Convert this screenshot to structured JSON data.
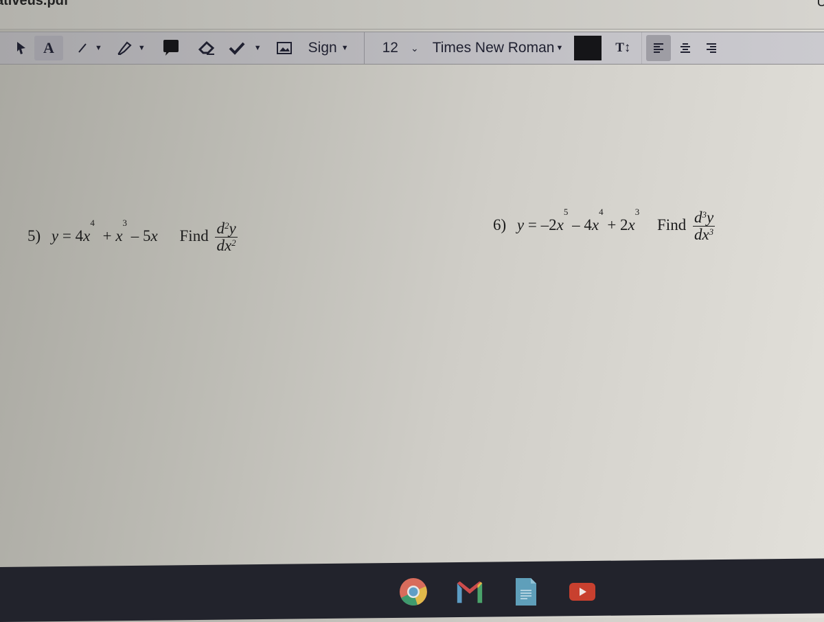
{
  "window": {
    "title_fragment": "ativeus.pdf",
    "title_right_fragment": "U"
  },
  "toolbar": {
    "tools": [
      {
        "name": "select-tool",
        "icon": "cursor-arrow-icon"
      },
      {
        "name": "text-tool",
        "icon": "text-A-icon",
        "label": "A",
        "active": true
      },
      {
        "name": "line-tool",
        "icon": "line-icon"
      },
      {
        "name": "highlighter-tool",
        "icon": "highlighter-icon"
      },
      {
        "name": "comment-tool",
        "icon": "speech-bubble-icon"
      },
      {
        "name": "eraser-tool",
        "icon": "eraser-icon"
      },
      {
        "name": "checkmark-tool",
        "icon": "checkmark-icon"
      },
      {
        "name": "image-tool",
        "icon": "image-icon"
      }
    ],
    "sign_label": "Sign",
    "font_size": "12",
    "font_family": "Times New Roman",
    "text_color": "#151518",
    "text_size_icon_label": "T↕",
    "align_options": [
      "align-left",
      "align-center",
      "align-right"
    ],
    "active_align": "align-left"
  },
  "document": {
    "problems": [
      {
        "number": "5)",
        "equation_lhs": "y",
        "equals": "=",
        "terms": [
          {
            "coef": "4",
            "var": "x",
            "exp": "4"
          },
          {
            "op": "+",
            "coef": "",
            "var": "x",
            "exp": "3"
          },
          {
            "op": "–",
            "coef": "5",
            "var": "x",
            "exp": ""
          }
        ],
        "find_label": "Find",
        "derivative": {
          "numerator": "d",
          "num_exp": "2",
          "num_var": "y",
          "denominator": "dx",
          "den_exp": "2"
        }
      },
      {
        "number": "6)",
        "equation_lhs": "y",
        "equals": "=",
        "terms": [
          {
            "coef": "–2",
            "var": "x",
            "exp": "5"
          },
          {
            "op": "–",
            "coef": "4",
            "var": "x",
            "exp": "4"
          },
          {
            "op": "+",
            "coef": "2",
            "var": "x",
            "exp": "3"
          }
        ],
        "find_label": "Find",
        "derivative": {
          "numerator": "d",
          "num_exp": "3",
          "num_var": "y",
          "denominator": "dx",
          "den_exp": "3"
        }
      }
    ]
  },
  "shelf": {
    "apps": [
      {
        "name": "chrome",
        "icon": "chrome-icon"
      },
      {
        "name": "gmail",
        "icon": "gmail-icon"
      },
      {
        "name": "docs",
        "icon": "google-docs-icon"
      },
      {
        "name": "youtube",
        "icon": "youtube-icon"
      }
    ]
  }
}
